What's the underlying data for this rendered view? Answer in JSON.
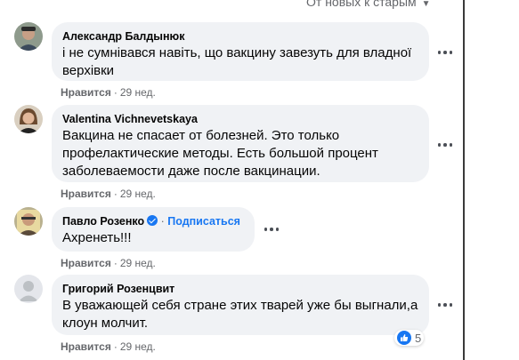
{
  "sort_label": "От новых к старым",
  "comments": [
    {
      "author": "Александр Балдынюк",
      "text": "і не сумнівався навіть, що вакцину завезуть для владної верхівки",
      "like_label": "Нравится",
      "time": "29 нед."
    },
    {
      "author": "Valentina Vichnevetskaya",
      "text": "Вакцина не спасает от болезней. Это только профелактические методы. Есть большой процент заболеваемости даже после вакцинации.",
      "like_label": "Нравится",
      "time": "29 нед."
    },
    {
      "author": "Павло Розенко",
      "subscribe": "Подписаться",
      "text": "Ахренеть!!!",
      "like_label": "Нравится",
      "time": "29 нед."
    },
    {
      "author": "Григорий Розенцвит",
      "text": "В уважающей себя стране этих тварей уже бы выгнали,а клоун молчит.",
      "like_label": "Нравится",
      "time": "29 нед.",
      "reaction_count": "5"
    }
  ],
  "colors": {
    "bubble": "#f0f2f5",
    "accent": "#1877f2",
    "secondary_text": "#65676b"
  },
  "icons": [
    "more-icon",
    "verified-badge-icon",
    "like-reaction-icon",
    "chevron-down-icon"
  ]
}
